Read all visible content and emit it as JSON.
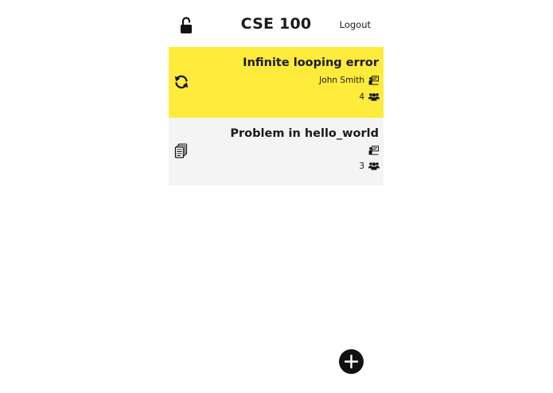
{
  "header": {
    "title": "CSE 100",
    "logout_label": "Logout",
    "lock_icon": "unlocked-padlock-icon"
  },
  "tickets": [
    {
      "title": "Infinite looping error",
      "assignee": "John Smith",
      "assignee_icon": "tutor-at-board-icon",
      "count": "4",
      "count_icon": "users-group-icon",
      "status_icon": "refresh-icon",
      "background": "#ffeb3b"
    },
    {
      "title": "Problem in hello_world",
      "assignee": "",
      "assignee_icon": "tutor-at-board-icon",
      "count": "3",
      "count_icon": "users-group-icon",
      "status_icon": "documents-icon",
      "background": "#f4f4f4"
    }
  ],
  "fab": {
    "icon": "plus-icon",
    "color": "#111111"
  }
}
